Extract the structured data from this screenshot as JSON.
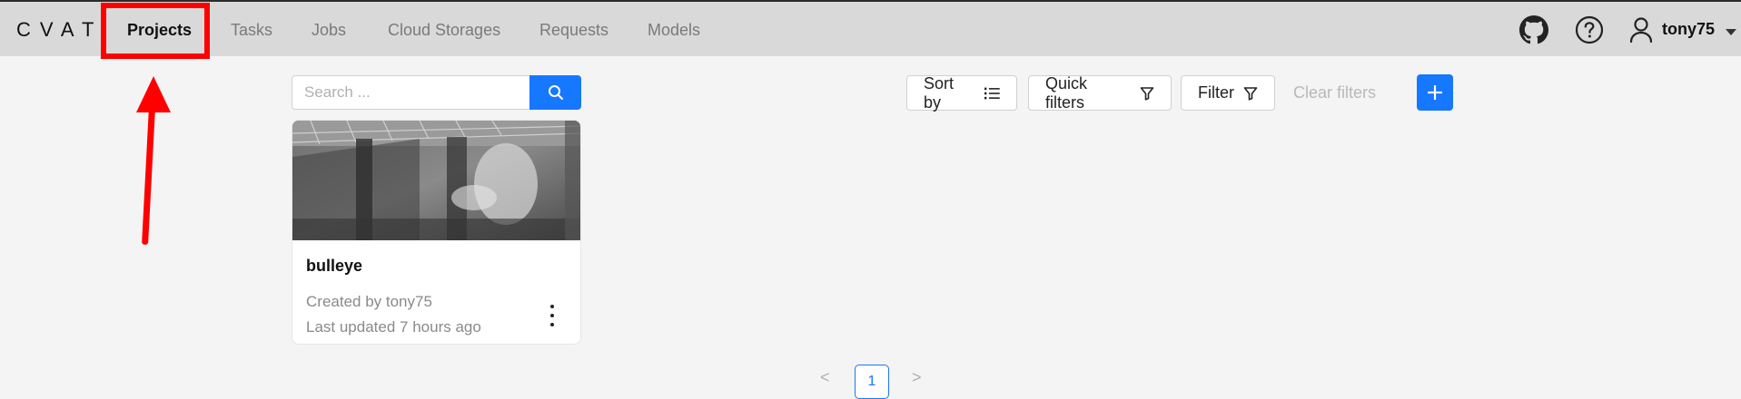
{
  "app": {
    "logo_text": "CVAT"
  },
  "nav": {
    "items": [
      {
        "label": "Projects",
        "active": true
      },
      {
        "label": "Tasks",
        "active": false
      },
      {
        "label": "Jobs",
        "active": false
      },
      {
        "label": "Cloud Storages",
        "active": false
      },
      {
        "label": "Requests",
        "active": false
      },
      {
        "label": "Models",
        "active": false
      }
    ]
  },
  "header_right": {
    "icons": [
      "github-icon",
      "help-icon",
      "user-icon",
      "caret-down-icon"
    ],
    "username": "tony75"
  },
  "toolbar": {
    "search_placeholder": "Search ...",
    "sort_label": "Sort by",
    "quick_filters_label": "Quick filters",
    "filter_label": "Filter",
    "clear_filters_label": "Clear filters"
  },
  "projects": [
    {
      "name": "bulleye",
      "created_by": "Created by tony75",
      "last_updated": "Last updated 7 hours ago"
    }
  ],
  "pagination": {
    "prev": "<",
    "current_page": "1",
    "next": ">"
  },
  "colors": {
    "accent": "#1677ff",
    "annotation": "#ff0000",
    "topbar": "#d9d9d9"
  }
}
